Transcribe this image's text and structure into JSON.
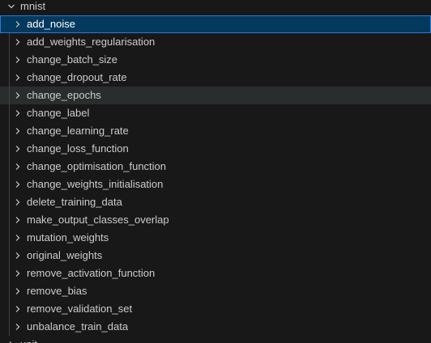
{
  "explorer": {
    "folder": {
      "label": "mnist",
      "expanded": true,
      "icon": "chevron-down-icon"
    },
    "items": [
      {
        "label": "add_noise",
        "state": "selected"
      },
      {
        "label": "add_weights_regularisation",
        "state": "normal"
      },
      {
        "label": "change_batch_size",
        "state": "normal"
      },
      {
        "label": "change_dropout_rate",
        "state": "normal"
      },
      {
        "label": "change_epochs",
        "state": "hover"
      },
      {
        "label": "change_label",
        "state": "normal"
      },
      {
        "label": "change_learning_rate",
        "state": "normal"
      },
      {
        "label": "change_loss_function",
        "state": "normal"
      },
      {
        "label": "change_optimisation_function",
        "state": "normal"
      },
      {
        "label": "change_weights_initialisation",
        "state": "normal"
      },
      {
        "label": "delete_training_data",
        "state": "normal"
      },
      {
        "label": "make_output_classes_overlap",
        "state": "normal"
      },
      {
        "label": "mutation_weights",
        "state": "normal"
      },
      {
        "label": "original_weights",
        "state": "normal"
      },
      {
        "label": "remove_activation_function",
        "state": "normal"
      },
      {
        "label": "remove_bias",
        "state": "normal"
      },
      {
        "label": "remove_validation_set",
        "state": "normal"
      },
      {
        "label": "unbalance_train_data",
        "state": "normal"
      }
    ],
    "next_folder": {
      "label": "unit",
      "expanded": false,
      "icon": "chevron-right-icon"
    },
    "colors": {
      "background": "#181818",
      "text": "#cccccc",
      "selected_background": "#04395e",
      "selected_border": "#2b79d8",
      "hover_background": "#2a2d2e",
      "indent_guide": "#404040"
    }
  }
}
